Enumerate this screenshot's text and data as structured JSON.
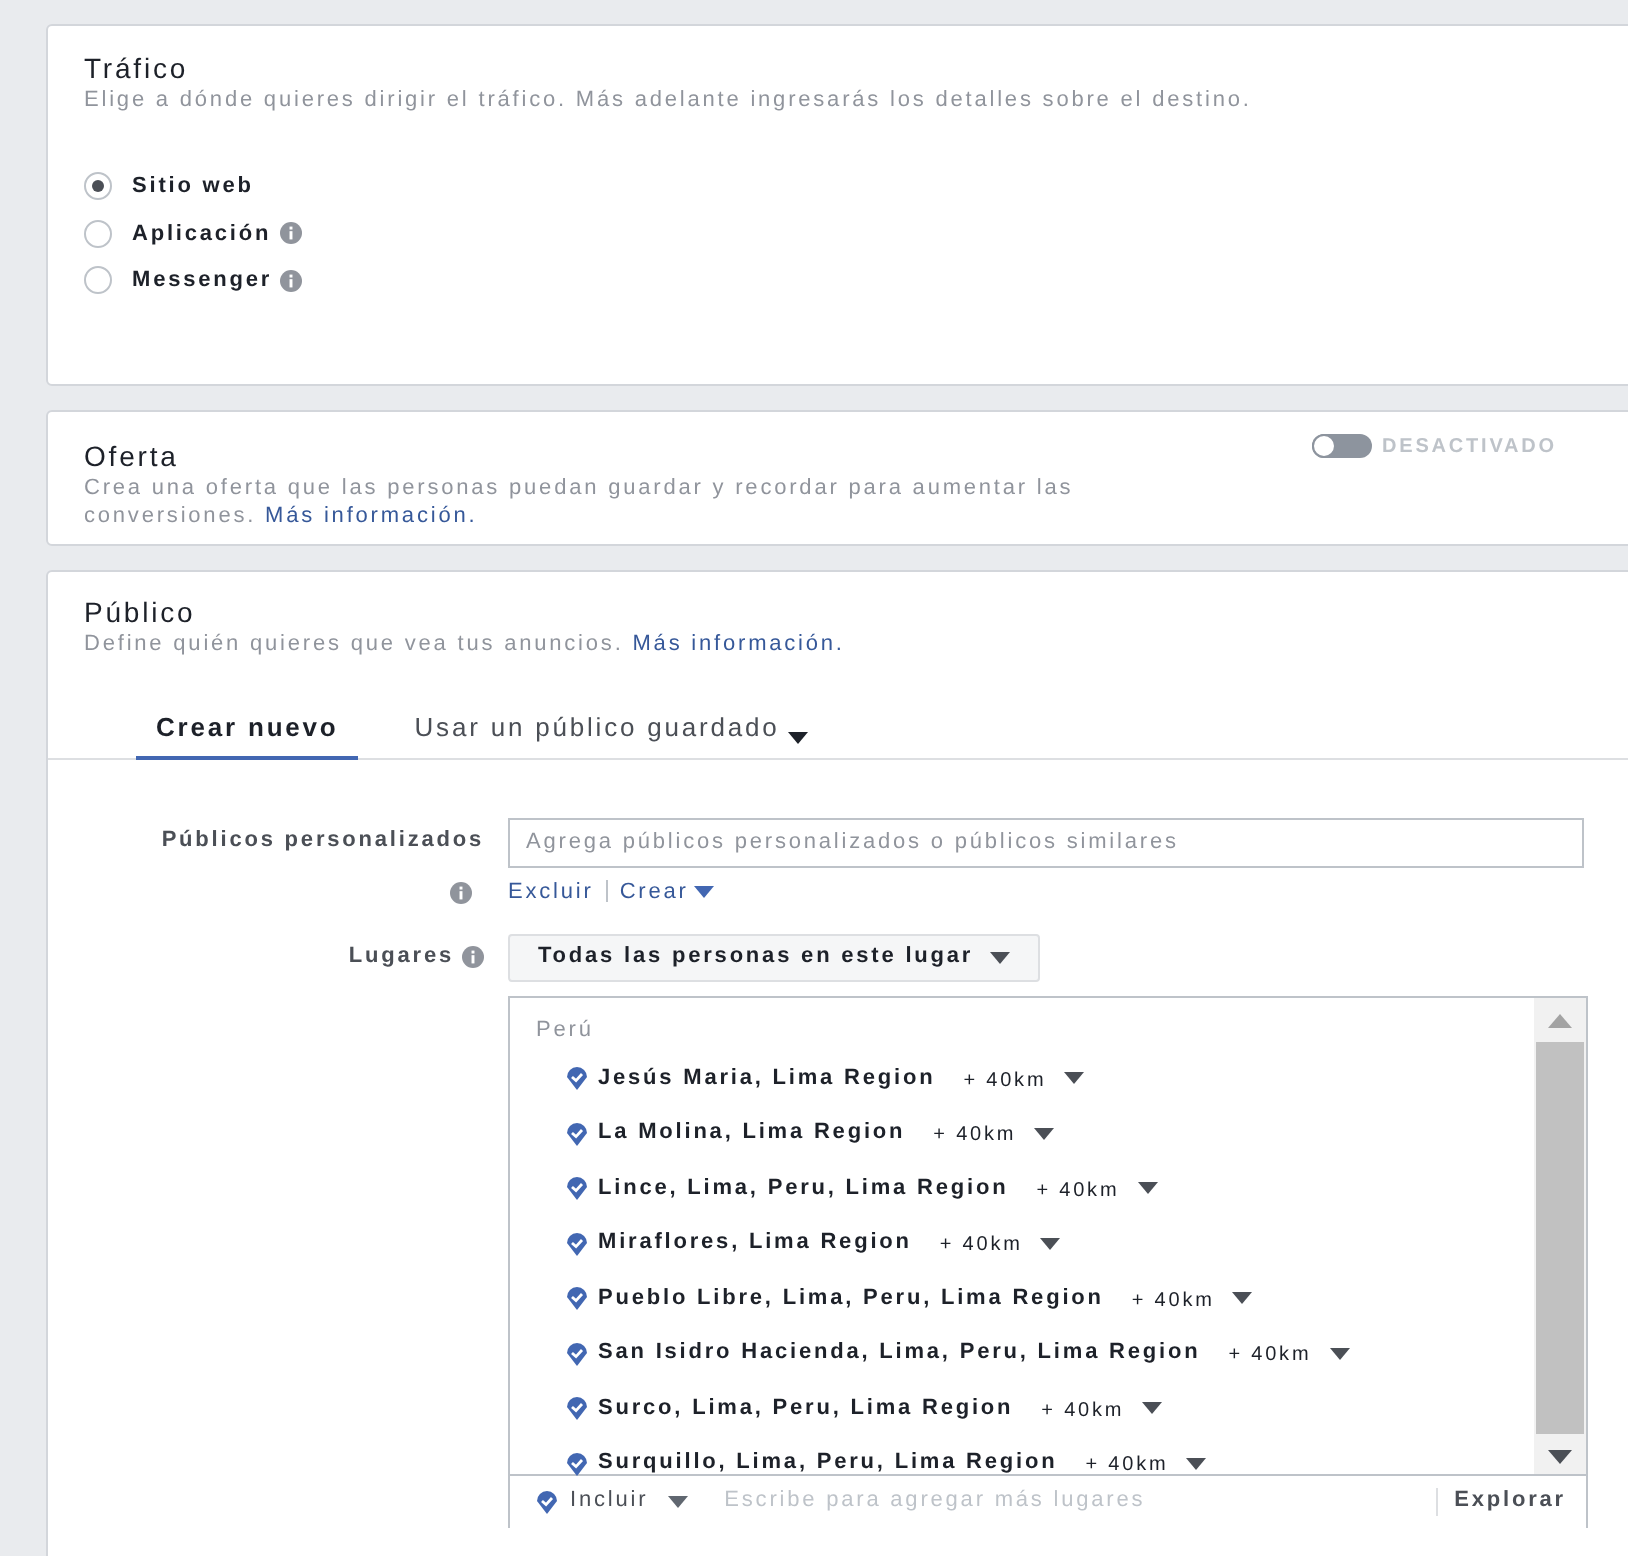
{
  "traffic": {
    "title": "Tráfico",
    "description": "Elige a dónde quieres dirigir el tráfico. Más adelante ingresarás los detalles sobre el destino.",
    "options": [
      {
        "label": "Sitio web",
        "selected": true,
        "info": false
      },
      {
        "label": "Aplicación",
        "selected": false,
        "info": true
      },
      {
        "label": "Messenger",
        "selected": false,
        "info": true
      }
    ]
  },
  "offer": {
    "title": "Oferta",
    "description": "Crea una oferta que las personas puedan guardar y recordar para aumentar las conversiones.",
    "link": "Más información.",
    "toggle": {
      "on": false,
      "label": "DESACTIVADO"
    }
  },
  "audience": {
    "title": "Público",
    "description": "Define quién quieres que vea tus anuncios.",
    "link": "Más información.",
    "tabs": [
      {
        "label": "Crear nuevo",
        "selected": true,
        "dropdown": false
      },
      {
        "label": "Usar un público guardado",
        "selected": false,
        "dropdown": true
      }
    ],
    "custom_audiences": {
      "label": "Públicos personalizados",
      "placeholder": "Agrega públicos personalizados o públicos similares",
      "actions": [
        {
          "label": "Excluir",
          "dropdown": false
        },
        {
          "label": "Crear",
          "dropdown": true
        }
      ]
    },
    "locations": {
      "label": "Lugares",
      "filter": "Todas las personas en este lugar",
      "group": "Perú",
      "items": [
        {
          "name": "Jesús Maria, Lima Region",
          "radius": "+ 40km"
        },
        {
          "name": "La Molina, Lima Region",
          "radius": "+ 40km"
        },
        {
          "name": "Lince, Lima, Peru, Lima Region",
          "radius": "+ 40km"
        },
        {
          "name": "Miraflores, Lima Region",
          "radius": "+ 40km"
        },
        {
          "name": "Pueblo Libre, Lima, Peru, Lima Region",
          "radius": "+ 40km"
        },
        {
          "name": "San Isidro Hacienda, Lima, Peru, Lima Region",
          "radius": "+ 40km"
        },
        {
          "name": "Surco, Lima, Peru, Lima Region",
          "radius": "+ 40km"
        },
        {
          "name": "Surquillo, Lima, Peru, Lima Region",
          "radius": "+ 40km"
        }
      ],
      "include": "Incluir",
      "placeholder": "Escribe para agregar más lugares",
      "explore": "Explorar"
    }
  }
}
